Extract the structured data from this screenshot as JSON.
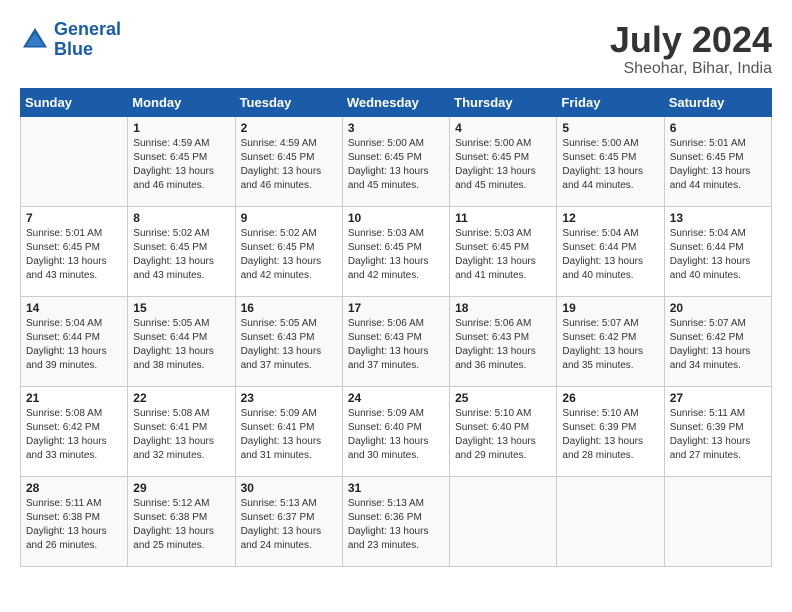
{
  "header": {
    "logo_line1": "General",
    "logo_line2": "Blue",
    "month_year": "July 2024",
    "location": "Sheohar, Bihar, India"
  },
  "weekdays": [
    "Sunday",
    "Monday",
    "Tuesday",
    "Wednesday",
    "Thursday",
    "Friday",
    "Saturday"
  ],
  "weeks": [
    [
      {
        "day": "",
        "sunrise": "",
        "sunset": "",
        "daylight": ""
      },
      {
        "day": "1",
        "sunrise": "Sunrise: 4:59 AM",
        "sunset": "Sunset: 6:45 PM",
        "daylight": "Daylight: 13 hours and 46 minutes."
      },
      {
        "day": "2",
        "sunrise": "Sunrise: 4:59 AM",
        "sunset": "Sunset: 6:45 PM",
        "daylight": "Daylight: 13 hours and 46 minutes."
      },
      {
        "day": "3",
        "sunrise": "Sunrise: 5:00 AM",
        "sunset": "Sunset: 6:45 PM",
        "daylight": "Daylight: 13 hours and 45 minutes."
      },
      {
        "day": "4",
        "sunrise": "Sunrise: 5:00 AM",
        "sunset": "Sunset: 6:45 PM",
        "daylight": "Daylight: 13 hours and 45 minutes."
      },
      {
        "day": "5",
        "sunrise": "Sunrise: 5:00 AM",
        "sunset": "Sunset: 6:45 PM",
        "daylight": "Daylight: 13 hours and 44 minutes."
      },
      {
        "day": "6",
        "sunrise": "Sunrise: 5:01 AM",
        "sunset": "Sunset: 6:45 PM",
        "daylight": "Daylight: 13 hours and 44 minutes."
      }
    ],
    [
      {
        "day": "7",
        "sunrise": "Sunrise: 5:01 AM",
        "sunset": "Sunset: 6:45 PM",
        "daylight": "Daylight: 13 hours and 43 minutes."
      },
      {
        "day": "8",
        "sunrise": "Sunrise: 5:02 AM",
        "sunset": "Sunset: 6:45 PM",
        "daylight": "Daylight: 13 hours and 43 minutes."
      },
      {
        "day": "9",
        "sunrise": "Sunrise: 5:02 AM",
        "sunset": "Sunset: 6:45 PM",
        "daylight": "Daylight: 13 hours and 42 minutes."
      },
      {
        "day": "10",
        "sunrise": "Sunrise: 5:03 AM",
        "sunset": "Sunset: 6:45 PM",
        "daylight": "Daylight: 13 hours and 42 minutes."
      },
      {
        "day": "11",
        "sunrise": "Sunrise: 5:03 AM",
        "sunset": "Sunset: 6:45 PM",
        "daylight": "Daylight: 13 hours and 41 minutes."
      },
      {
        "day": "12",
        "sunrise": "Sunrise: 5:04 AM",
        "sunset": "Sunset: 6:44 PM",
        "daylight": "Daylight: 13 hours and 40 minutes."
      },
      {
        "day": "13",
        "sunrise": "Sunrise: 5:04 AM",
        "sunset": "Sunset: 6:44 PM",
        "daylight": "Daylight: 13 hours and 40 minutes."
      }
    ],
    [
      {
        "day": "14",
        "sunrise": "Sunrise: 5:04 AM",
        "sunset": "Sunset: 6:44 PM",
        "daylight": "Daylight: 13 hours and 39 minutes."
      },
      {
        "day": "15",
        "sunrise": "Sunrise: 5:05 AM",
        "sunset": "Sunset: 6:44 PM",
        "daylight": "Daylight: 13 hours and 38 minutes."
      },
      {
        "day": "16",
        "sunrise": "Sunrise: 5:05 AM",
        "sunset": "Sunset: 6:43 PM",
        "daylight": "Daylight: 13 hours and 37 minutes."
      },
      {
        "day": "17",
        "sunrise": "Sunrise: 5:06 AM",
        "sunset": "Sunset: 6:43 PM",
        "daylight": "Daylight: 13 hours and 37 minutes."
      },
      {
        "day": "18",
        "sunrise": "Sunrise: 5:06 AM",
        "sunset": "Sunset: 6:43 PM",
        "daylight": "Daylight: 13 hours and 36 minutes."
      },
      {
        "day": "19",
        "sunrise": "Sunrise: 5:07 AM",
        "sunset": "Sunset: 6:42 PM",
        "daylight": "Daylight: 13 hours and 35 minutes."
      },
      {
        "day": "20",
        "sunrise": "Sunrise: 5:07 AM",
        "sunset": "Sunset: 6:42 PM",
        "daylight": "Daylight: 13 hours and 34 minutes."
      }
    ],
    [
      {
        "day": "21",
        "sunrise": "Sunrise: 5:08 AM",
        "sunset": "Sunset: 6:42 PM",
        "daylight": "Daylight: 13 hours and 33 minutes."
      },
      {
        "day": "22",
        "sunrise": "Sunrise: 5:08 AM",
        "sunset": "Sunset: 6:41 PM",
        "daylight": "Daylight: 13 hours and 32 minutes."
      },
      {
        "day": "23",
        "sunrise": "Sunrise: 5:09 AM",
        "sunset": "Sunset: 6:41 PM",
        "daylight": "Daylight: 13 hours and 31 minutes."
      },
      {
        "day": "24",
        "sunrise": "Sunrise: 5:09 AM",
        "sunset": "Sunset: 6:40 PM",
        "daylight": "Daylight: 13 hours and 30 minutes."
      },
      {
        "day": "25",
        "sunrise": "Sunrise: 5:10 AM",
        "sunset": "Sunset: 6:40 PM",
        "daylight": "Daylight: 13 hours and 29 minutes."
      },
      {
        "day": "26",
        "sunrise": "Sunrise: 5:10 AM",
        "sunset": "Sunset: 6:39 PM",
        "daylight": "Daylight: 13 hours and 28 minutes."
      },
      {
        "day": "27",
        "sunrise": "Sunrise: 5:11 AM",
        "sunset": "Sunset: 6:39 PM",
        "daylight": "Daylight: 13 hours and 27 minutes."
      }
    ],
    [
      {
        "day": "28",
        "sunrise": "Sunrise: 5:11 AM",
        "sunset": "Sunset: 6:38 PM",
        "daylight": "Daylight: 13 hours and 26 minutes."
      },
      {
        "day": "29",
        "sunrise": "Sunrise: 5:12 AM",
        "sunset": "Sunset: 6:38 PM",
        "daylight": "Daylight: 13 hours and 25 minutes."
      },
      {
        "day": "30",
        "sunrise": "Sunrise: 5:13 AM",
        "sunset": "Sunset: 6:37 PM",
        "daylight": "Daylight: 13 hours and 24 minutes."
      },
      {
        "day": "31",
        "sunrise": "Sunrise: 5:13 AM",
        "sunset": "Sunset: 6:36 PM",
        "daylight": "Daylight: 13 hours and 23 minutes."
      },
      {
        "day": "",
        "sunrise": "",
        "sunset": "",
        "daylight": ""
      },
      {
        "day": "",
        "sunrise": "",
        "sunset": "",
        "daylight": ""
      },
      {
        "day": "",
        "sunrise": "",
        "sunset": "",
        "daylight": ""
      }
    ]
  ]
}
